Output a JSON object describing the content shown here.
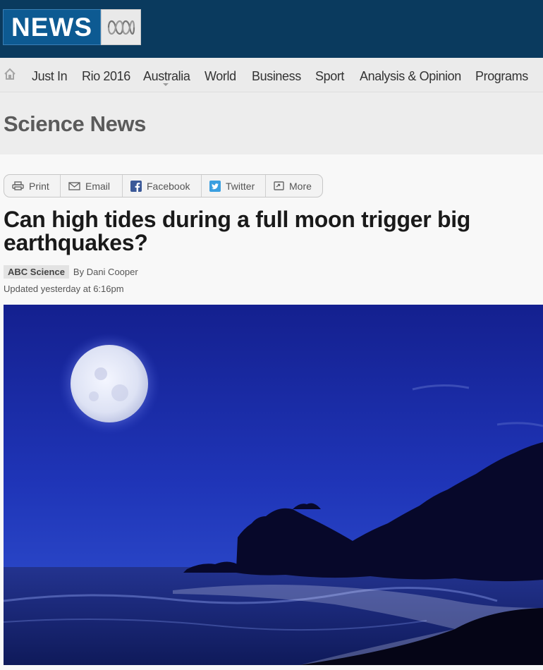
{
  "header": {
    "logo_text": "NEWS",
    "logo_brand": "ABC"
  },
  "nav": {
    "items": [
      "Just In",
      "Rio 2016",
      "Australia",
      "World",
      "Business",
      "Sport",
      "Analysis & Opinion",
      "Programs"
    ],
    "active": "Australia"
  },
  "section": {
    "title": "Science News"
  },
  "share": {
    "print": "Print",
    "email": "Email",
    "facebook": "Facebook",
    "twitter": "Twitter",
    "more": "More"
  },
  "article": {
    "title": "Can high tides during a full moon trigger big earthquakes?",
    "source": "ABC Science",
    "byline": "By Dani Cooper",
    "updated": "Updated yesterday at 6:16pm"
  },
  "colors": {
    "header_bg": "#0a3a5e",
    "logo_blue": "#0d5a92",
    "facebook": "#3b5998",
    "twitter": "#3a9fe0",
    "night_sky": "#1a2bb0"
  }
}
